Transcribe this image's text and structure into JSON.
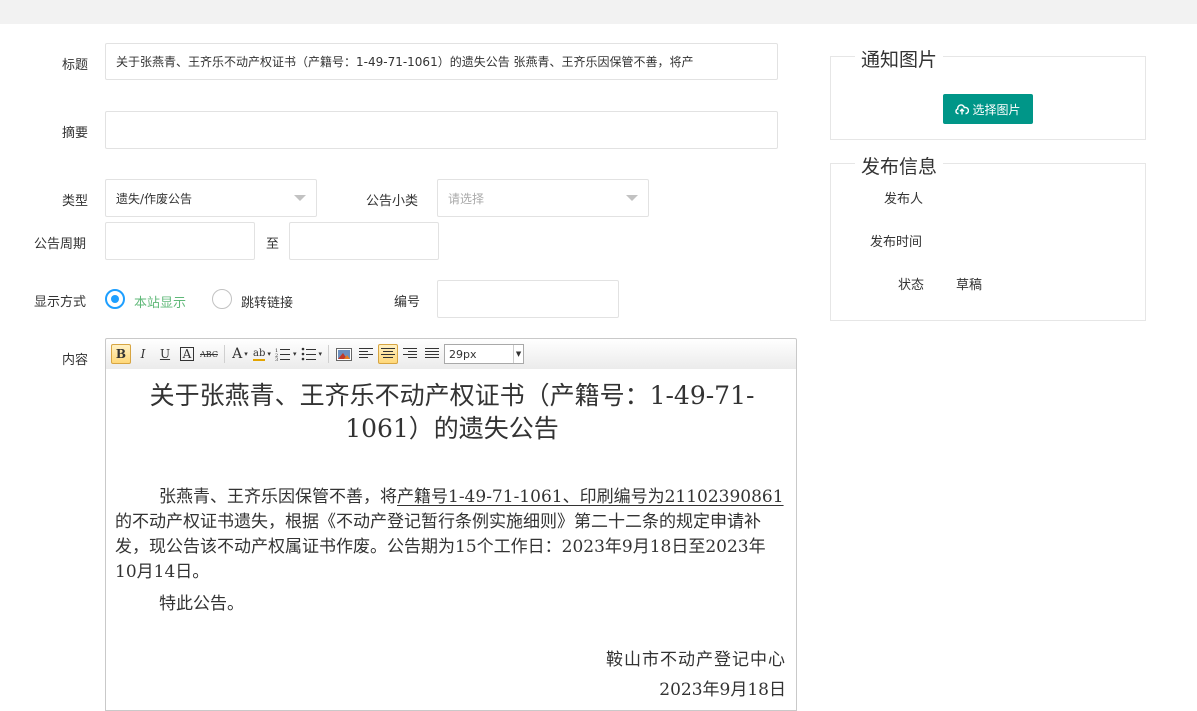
{
  "form": {
    "title_label": "标题",
    "title_value": "关于张燕青、王齐乐不动产权证书（产籍号：1-49-71-1061）的遗失公告  张燕青、王齐乐因保管不善，将产",
    "summary_label": "摘要",
    "summary_value": "",
    "type_label": "类型",
    "type_value": "遗失/作废公告",
    "subtype_label": "公告小类",
    "subtype_placeholder": "请选择",
    "period_label": "公告周期",
    "period_to": "至",
    "period_start": "",
    "period_end": "",
    "display_label": "显示方式",
    "display_options": [
      "本站显示",
      "跳转链接"
    ],
    "display_selected": "本站显示",
    "number_label": "编号",
    "number_value": "",
    "content_label": "内容"
  },
  "toolbar": {
    "bold": "B",
    "italic": "I",
    "underline": "U",
    "box": "A",
    "strike": "ABC",
    "fontcolor": "A",
    "highlight": "ab",
    "fontsize": "29px"
  },
  "editor": {
    "title": "关于张燕青、王齐乐不动产权证书（产籍号：1-49-71-1061）的遗失公告",
    "body_pre": "张燕青、王齐乐因保管不善，将",
    "body_underlined": "产籍号1-49-71-1061、印刷编号为21102390861",
    "body_post": "的不动产权证书遗失，根据《不动产登记暂行条例实施细则》第二十二条的规定申请补发，现公告该不动产权属证书作废。公告期为15个工作日：2023年9月18日至2023年10月14日。",
    "closing": "特此公告。",
    "org": "鞍山市不动产登记中心",
    "date": "2023年9月18日"
  },
  "notice_image": {
    "legend": "通知图片",
    "button": "选择图片"
  },
  "publish_info": {
    "legend": "发布信息",
    "publisher_label": "发布人",
    "publisher_value": "",
    "time_label": "发布时间",
    "time_value": "",
    "status_label": "状态",
    "status_value": "草稿"
  },
  "colors": {
    "accent_teal": "#009688",
    "radio_blue": "#1e9fff",
    "selected_text_green": "#5fb878"
  }
}
